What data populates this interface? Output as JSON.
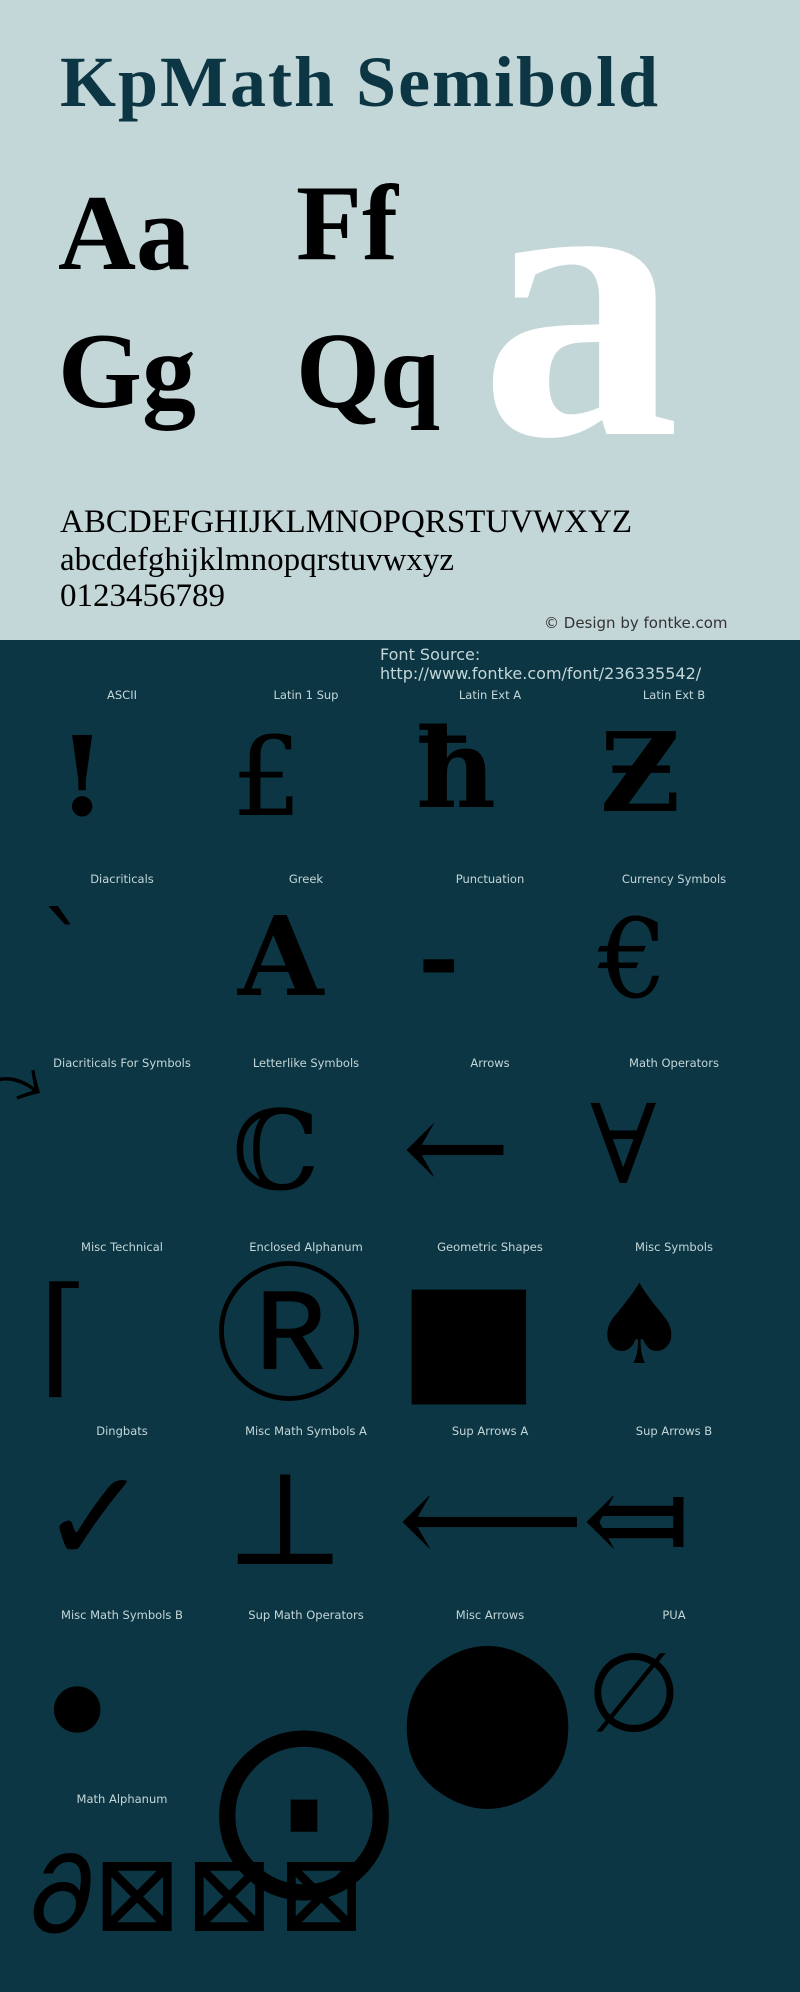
{
  "header": {
    "title": "KpMath Semibold",
    "pairs": [
      "Aa",
      "Ff",
      "Gg",
      "Qq"
    ],
    "hero_glyph": "a",
    "uppercase": "ABCDEFGHIJKLMNOPQRSTUVWXYZ",
    "lowercase": "abcdefghijklmnopqrstuvwxyz",
    "digits": "0123456789",
    "credit": "© Design by fontke.com"
  },
  "source": "Font Source: http://www.fontke.com/font/236335542/",
  "colors": {
    "header_bg": "#c4d7d8",
    "body_bg": "#0d3644",
    "title": "#0d3644",
    "label": "#c4d7d8"
  },
  "blocks": [
    {
      "label": "ASCII",
      "glyph": "!"
    },
    {
      "label": "Latin 1 Sup",
      "glyph": "£"
    },
    {
      "label": "Latin Ext A",
      "glyph": "ħ"
    },
    {
      "label": "Latin Ext B",
      "glyph": "Ƶ"
    },
    {
      "label": "Diacriticals",
      "glyph": "ˋ"
    },
    {
      "label": "Greek",
      "glyph": "Α"
    },
    {
      "label": "Punctuation",
      "glyph": "‐"
    },
    {
      "label": "Currency Symbols",
      "glyph": "€"
    },
    {
      "label": "Diacriticals For Symbols",
      "glyph": "⃕"
    },
    {
      "label": "Letterlike Symbols",
      "glyph": "ℂ"
    },
    {
      "label": "Arrows",
      "glyph": "←"
    },
    {
      "label": "Math Operators",
      "glyph": "∀"
    },
    {
      "label": "Misc Technical",
      "glyph": "⌈"
    },
    {
      "label": "Enclosed Alphanum",
      "glyph": "Ⓡ"
    },
    {
      "label": "Geometric Shapes",
      "glyph": "■"
    },
    {
      "label": "Misc Symbols",
      "glyph": "♠"
    },
    {
      "label": "Dingbats",
      "glyph": "✓"
    },
    {
      "label": "Misc Math Symbols A",
      "glyph": "⊥"
    },
    {
      "label": "Sup Arrows A",
      "glyph": "⟵"
    },
    {
      "label": "Sup Arrows B",
      "glyph": "⤆"
    },
    {
      "label": "Misc Math Symbols B",
      "glyph": "•"
    },
    {
      "label": "Sup Math Operators",
      "glyph": "⨀"
    },
    {
      "label": "Misc Arrows",
      "glyph": "⬤"
    },
    {
      "label": "PUA",
      "glyph": "∅"
    },
    {
      "label": "Math Alphanum",
      "glyph": "𝜕⊠⊠⊠"
    }
  ]
}
